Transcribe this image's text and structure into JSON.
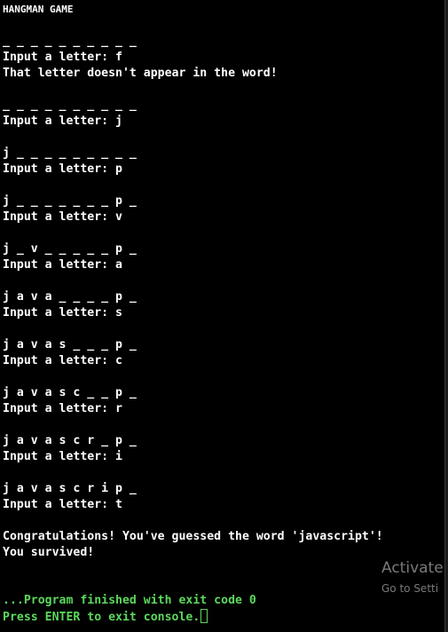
{
  "console": {
    "title": "HANGMAN GAME",
    "lines": [
      "_ _ _ _ _ _ _ _ _ _",
      "Input a letter: f",
      "That letter doesn't appear in the word!",
      "_ _ _ _ _ _ _ _ _ _",
      "Input a letter: j",
      "j _ _ _ _ _ _ _ _ _",
      "Input a letter: p",
      "j _ _ _ _ _ _ _ p _",
      "Input a letter: v",
      "j _ v _ _ _ _ _ p _",
      "Input a letter: a",
      "j a v a _ _ _ _ p _",
      "Input a letter: s",
      "j a v a s _ _ _ p _",
      "Input a letter: c",
      "j a v a s c _ _ p _",
      "Input a letter: r",
      "j a v a s c r _ p _",
      "Input a letter: i",
      "j a v a s c r i p _",
      "Input a letter: t",
      "Congratulations! You've guessed the word 'javascript'!",
      "You survived!"
    ],
    "exit_message": "...Program finished with exit code 0",
    "prompt": "Press ENTER to exit console."
  },
  "watermark": {
    "title": "Activate",
    "subtitle": "Go to Setti"
  },
  "colors": {
    "background": "#000000",
    "text": "#ffffff",
    "status_green": "#5cd85c",
    "watermark": "#7a7a7a"
  }
}
